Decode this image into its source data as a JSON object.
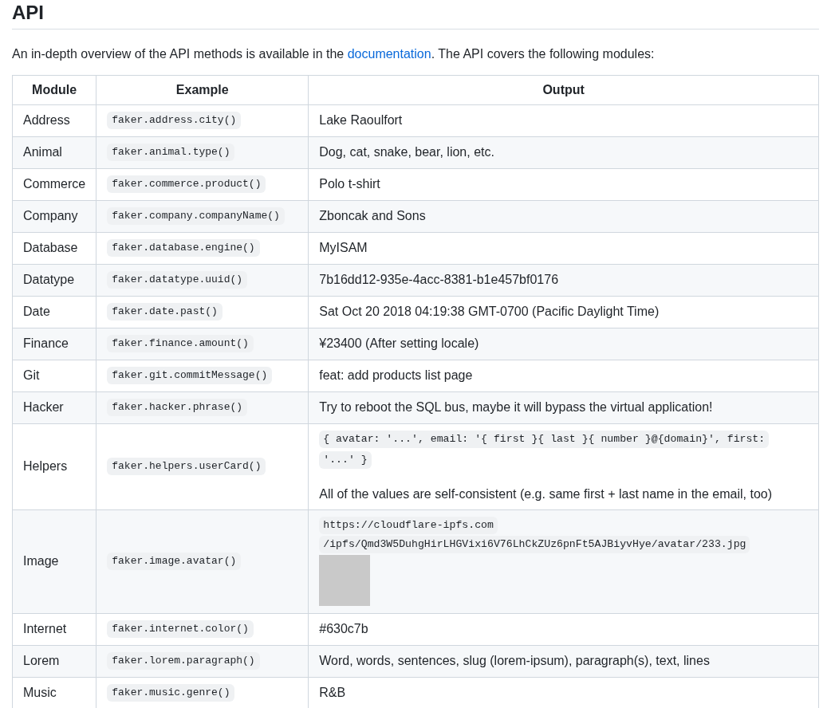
{
  "heading": "API",
  "intro": {
    "before": "An in-depth overview of the API methods is available in the ",
    "link": "documentation",
    "after": ". The API covers the following modules:"
  },
  "table": {
    "columns": [
      "Module",
      "Example",
      "Output"
    ],
    "rows": [
      {
        "module": "Address",
        "example": "faker.address.city()",
        "output": {
          "kind": "text",
          "text": "Lake Raoulfort"
        }
      },
      {
        "module": "Animal",
        "example": "faker.animal.type()",
        "output": {
          "kind": "text",
          "text": "Dog, cat, snake, bear, lion, etc."
        }
      },
      {
        "module": "Commerce",
        "example": "faker.commerce.product()",
        "output": {
          "kind": "text",
          "text": "Polo t-shirt"
        }
      },
      {
        "module": "Company",
        "example": "faker.company.companyName()",
        "output": {
          "kind": "text",
          "text": "Zboncak and Sons"
        }
      },
      {
        "module": "Database",
        "example": "faker.database.engine()",
        "output": {
          "kind": "text",
          "text": "MyISAM"
        }
      },
      {
        "module": "Datatype",
        "example": "faker.datatype.uuid()",
        "output": {
          "kind": "text",
          "text": "7b16dd12-935e-4acc-8381-b1e457bf0176"
        }
      },
      {
        "module": "Date",
        "example": "faker.date.past()",
        "output": {
          "kind": "text",
          "text": "Sat Oct 20 2018 04:19:38 GMT-0700 (Pacific Daylight Time)"
        }
      },
      {
        "module": "Finance",
        "example": "faker.finance.amount()",
        "output": {
          "kind": "text",
          "text": "¥23400 (After setting locale)"
        }
      },
      {
        "module": "Git",
        "example": "faker.git.commitMessage()",
        "output": {
          "kind": "text",
          "text": "feat: add products list page"
        }
      },
      {
        "module": "Hacker",
        "example": "faker.hacker.phrase()",
        "output": {
          "kind": "text",
          "text": "Try to reboot the SQL bus, maybe it will bypass the virtual application!"
        }
      },
      {
        "module": "Helpers",
        "example": "faker.helpers.userCard()",
        "output": {
          "kind": "code_note",
          "code_lines": [
            "{ avatar: '...', email: '{ first }{ last }{ number }@{domain}', first:",
            "'...' }"
          ],
          "text": "All of the values are self-consistent (e.g. same first + last name in the email, too)"
        }
      },
      {
        "module": "Image",
        "example": "faker.image.avatar()",
        "output": {
          "kind": "code_image",
          "code_lines": [
            "https://cloudflare-ipfs.com",
            "/ipfs/Qmd3W5DuhgHirLHGVixi6V76LhCkZUz6pnFt5AJBiyvHye/avatar/233.jpg"
          ]
        }
      },
      {
        "module": "Internet",
        "example": "faker.internet.color()",
        "output": {
          "kind": "text",
          "text": "#630c7b"
        }
      },
      {
        "module": "Lorem",
        "example": "faker.lorem.paragraph()",
        "output": {
          "kind": "text",
          "text": "Word, words, sentences, slug (lorem-ipsum), paragraph(s), text, lines"
        }
      },
      {
        "module": "Music",
        "example": "faker.music.genre()",
        "output": {
          "kind": "text",
          "text": "R&B"
        }
      }
    ]
  }
}
